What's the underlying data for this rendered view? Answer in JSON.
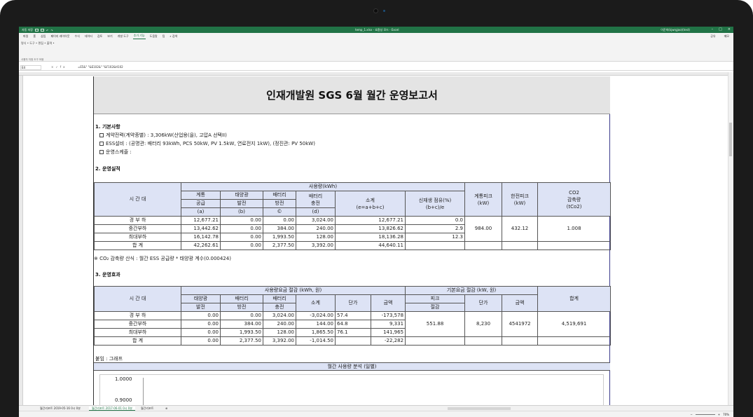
{
  "excel": {
    "autosave": "자동 저장",
    "file_title": "temp_1.xlsx - 호환성 모드 - Excel",
    "user": "이준희(kjwrgjoo)(test)",
    "menu": [
      "파일",
      "홈",
      "삽입",
      "페이지 레이아웃",
      "수식",
      "데이터",
      "검토",
      "보기",
      "개발 도구",
      "추가 기능",
      "도움말",
      "팀",
      "검색"
    ],
    "active_menu": "추가 기능",
    "share": "공유",
    "comment": "메모",
    "ribbon_row": "명식 • 도구 • 편집 • 출력 •",
    "ribbon_group": "사용자 지정 도구 모음",
    "name_box": "E4",
    "formula": "=E5&\" \"&E102&\" \"&F102&H102",
    "sheet_tabs": [
      "월간리포트 2019-05-16 0시 0분",
      "월간리포트 2017-06-01 0시 0분",
      "월간리포트"
    ],
    "active_tab_index": 1,
    "zoom": "70%"
  },
  "report": {
    "title": "인재개발원 SGS 6월 월간 운영보고서",
    "section1": "1. 기본사항",
    "info": [
      "계약전력(계약종별) : 3,306kW(산업용(을), 고압A 선택II)",
      "ESS설비 : (공명관: 배터리 93kWh, PCS 50kW, PV 1.5kW, 연료전지 1kW), (정진관: PV 50kW)",
      "운영스케줄 :"
    ],
    "section2": "2. 운영실적",
    "t1": {
      "time_header": "시 간 대",
      "usage_header": "사용량(kWh)",
      "col_grid": [
        "계통",
        "공급",
        "(a)"
      ],
      "col_pv": [
        "태양광",
        "발전",
        "(b)"
      ],
      "col_bat_out": [
        "배터리",
        "방전",
        "©"
      ],
      "col_bat_in": [
        "배터리",
        "충전",
        "(d)"
      ],
      "col_sum": [
        "소계",
        "(e=a+b+c)"
      ],
      "col_renew": [
        "신재생 점유(%)",
        "(b+c)/e"
      ],
      "col_peak": [
        "계통피크",
        "(kW)"
      ],
      "col_kepco": [
        "한전피크",
        "(kW)"
      ],
      "col_co2": [
        "CO2",
        "감축량",
        "(tCo2)"
      ],
      "rows": [
        {
          "label": "경 부 하",
          "a": "12,677.21",
          "b": "0.00",
          "c": "0.00",
          "d": "3,024.00",
          "e": "12,677.21",
          "r": "0.0"
        },
        {
          "label": "중간부하",
          "a": "13,442.62",
          "b": "0.00",
          "c": "384.00",
          "d": "240.00",
          "e": "13,826.62",
          "r": "2.9"
        },
        {
          "label": "최대부하",
          "a": "16,142.78",
          "b": "0.00",
          "c": "1,993.50",
          "d": "128.00",
          "e": "18,136.28",
          "r": "12.3"
        },
        {
          "label": "합 계",
          "a": "42,262.61",
          "b": "0.00",
          "c": "2,377.50",
          "d": "3,392.00",
          "e": "44,640.11",
          "r": ""
        }
      ],
      "peak": "984.00",
      "kepco": "432.12",
      "co2": "1.008"
    },
    "co2_note": "※ CO₂ 감축량 산식 : 월간 ESS 공급량 * 태양광 계수(0.000424)",
    "section3": "3. 운영효과",
    "t2": {
      "time_header": "시 간 대",
      "usage_save_header": "사용량요금 절감 (kWh, 원)",
      "base_save_header": "기본요금 절감 (kW, 원)",
      "total_header": "합계",
      "col_pv": [
        "태양광",
        "발전"
      ],
      "col_bat_out": [
        "배터리",
        "방전"
      ],
      "col_bat_in": [
        "배터리",
        "충전"
      ],
      "col_sum": "소계",
      "col_unit": "단가",
      "col_amount": "금액",
      "col_peak": [
        "피크",
        "절감"
      ],
      "col_unit2": "단가",
      "col_amount2": "금액",
      "rows": [
        {
          "label": "경 부 하",
          "pv": "0.00",
          "out": "0.00",
          "in": "3,024.00",
          "sum": "-3,024.00",
          "unit": "57.4",
          "amt": "-173,578"
        },
        {
          "label": "중간부하",
          "pv": "0.00",
          "out": "384.00",
          "in": "240.00",
          "sum": "144.00",
          "unit": "64.8",
          "amt": "9,331"
        },
        {
          "label": "최대부하",
          "pv": "0.00",
          "out": "1,993.50",
          "in": "128.00",
          "sum": "1,865.50",
          "unit": "76.1",
          "amt": "141,965"
        },
        {
          "label": "합 계",
          "pv": "0.00",
          "out": "2,377.50",
          "in": "3,392.00",
          "sum": "-1,014.50",
          "unit": "",
          "amt": "-22,282"
        }
      ],
      "peak_save": "551.88",
      "unit2": "8,230",
      "amount2": "4541972",
      "total": "4,519,691"
    },
    "attach_label": "붙임 : 그래프",
    "chart_title": "월간 사용량 분석 (일별)",
    "chart_yticks": [
      "1.0000",
      "0.9000"
    ]
  }
}
